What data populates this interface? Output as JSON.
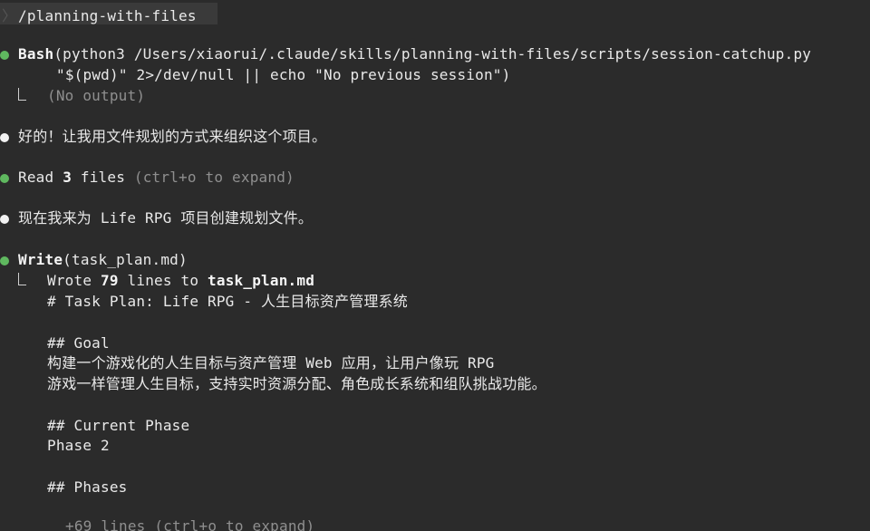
{
  "prompt": {
    "prefix": "〉",
    "command": "/planning-with-files"
  },
  "bash_call": {
    "tool": "Bash",
    "line1": "(python3 /Users/xiaorui/.claude/skills/planning-with-files/scripts/session-catchup.py",
    "line2": "\"$(pwd)\" 2>/dev/null || echo \"No previous session\")",
    "output": "(No output)"
  },
  "msg1": "好的！让我用文件规划的方式来组织这个项目。",
  "read_call": {
    "tool": "Read",
    "count": "3",
    "unit": "files",
    "hint": "(ctrl+o to expand)"
  },
  "msg2": "现在我来为 Life RPG 项目创建规划文件。",
  "write_call": {
    "tool": "Write",
    "args": "(task_plan.md)",
    "result_prefix": "Wrote",
    "result_count": "79",
    "result_mid": "lines to",
    "result_file": "task_plan.md",
    "content": [
      "# Task Plan: Life RPG - 人生目标资产管理系统",
      "",
      "## Goal",
      "构建一个游戏化的人生目标与资产管理 Web 应用，让用户像玩 RPG",
      "游戏一样管理人生目标，支持实时资源分配、角色成长系统和组队挑战功能。",
      "",
      "## Current Phase",
      "Phase 2",
      "",
      "## Phases"
    ],
    "more": "+69 lines (ctrl+o to expand)"
  },
  "colors": {
    "background": "#2b2b2b",
    "success_dot": "#5fb85f",
    "text": "#e9e9e9",
    "dim": "#8f8f8f"
  }
}
